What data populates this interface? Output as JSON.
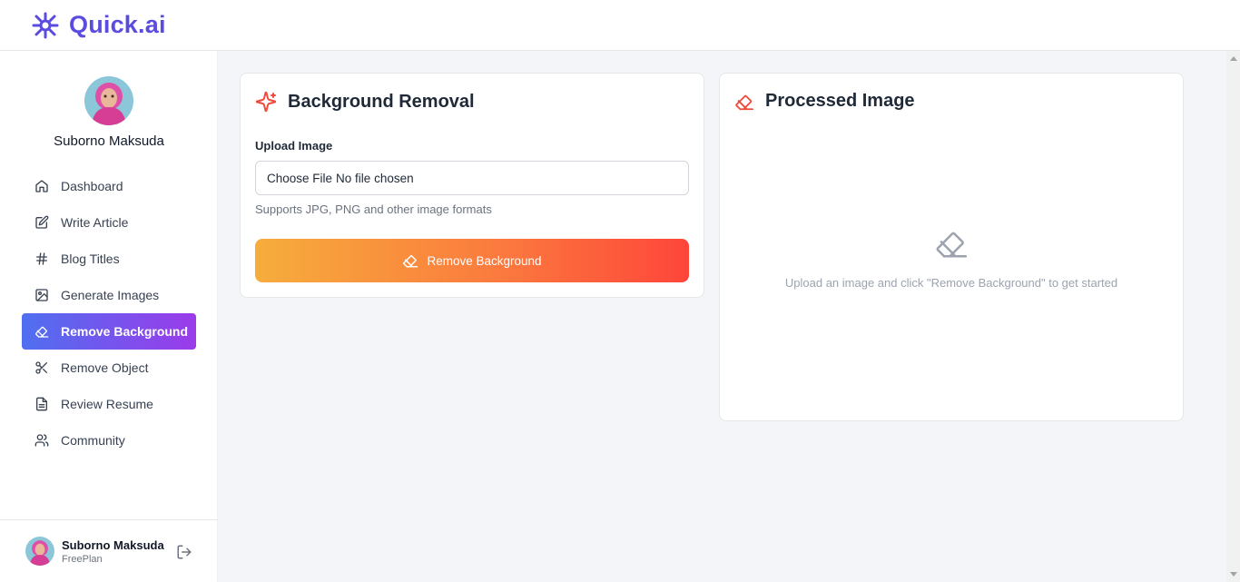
{
  "brand": {
    "name": "Quick.ai",
    "color": "#5b4ce0",
    "icon": "sparkle-logo-icon"
  },
  "profile": {
    "name": "Suborno Maksuda"
  },
  "nav": {
    "items": [
      {
        "label": "Dashboard",
        "icon": "home-icon",
        "active": false
      },
      {
        "label": "Write Article",
        "icon": "edit-icon",
        "active": false
      },
      {
        "label": "Blog Titles",
        "icon": "hash-icon",
        "active": false
      },
      {
        "label": "Generate Images",
        "icon": "image-icon",
        "active": false
      },
      {
        "label": "Remove Background",
        "icon": "eraser-icon",
        "active": true
      },
      {
        "label": "Remove Object",
        "icon": "scissors-icon",
        "active": false
      },
      {
        "label": "Review Resume",
        "icon": "file-text-icon",
        "active": false
      },
      {
        "label": "Community",
        "icon": "users-icon",
        "active": false
      }
    ]
  },
  "footer": {
    "name": "Suborno Maksuda",
    "plan": "FreePlan",
    "icon": "logout-icon"
  },
  "upload_card": {
    "title": "Background Removal",
    "icon": "sparkles-icon",
    "upload_label": "Upload Image",
    "file_button": "Choose File",
    "file_status": "No file chosen",
    "hint": "Supports JPG, PNG and other image formats",
    "button_label": "Remove Background",
    "accent": "#fe463a"
  },
  "result_card": {
    "title": "Processed Image",
    "icon": "eraser-icon",
    "empty_message": "Upload an image and click \"Remove Background\" to get started"
  }
}
